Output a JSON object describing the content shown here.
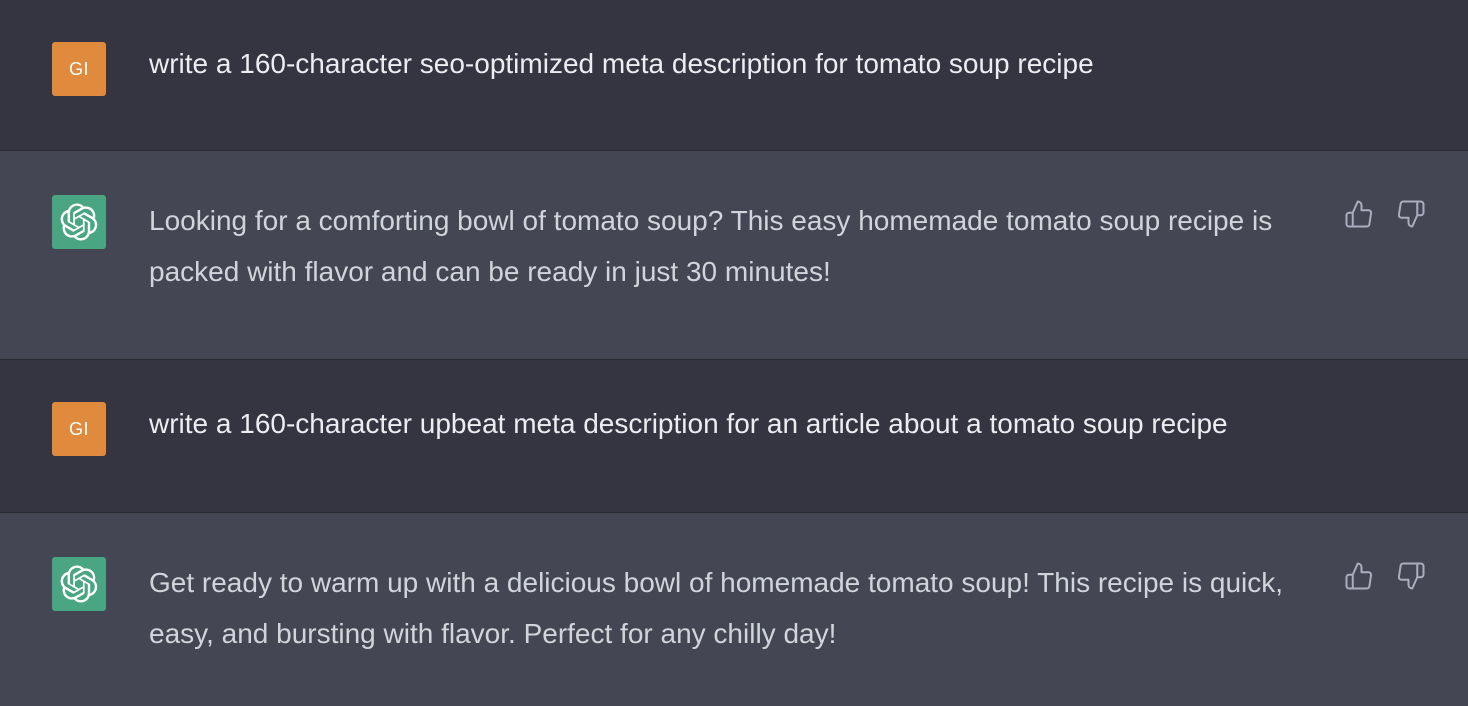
{
  "conversation": [
    {
      "role": "user",
      "avatar_initials": "GI",
      "avatar_color": "#df8a3d",
      "text": "write a 160-character seo-optimized meta description for tomato soup recipe"
    },
    {
      "role": "assistant",
      "avatar_icon": "openai-logo-icon",
      "avatar_color": "#4aa582",
      "text": "Looking for a comforting bowl of tomato soup? This easy homemade tomato soup recipe is packed with flavor and can be ready in just 30 minutes!",
      "feedback_icons": [
        "thumbs-up-icon",
        "thumbs-down-icon"
      ]
    },
    {
      "role": "user",
      "avatar_initials": "GI",
      "avatar_color": "#df8a3d",
      "text": "write a 160-character upbeat meta description for an article about a tomato soup recipe"
    },
    {
      "role": "assistant",
      "avatar_icon": "openai-logo-icon",
      "avatar_color": "#4aa582",
      "text": "Get ready to warm up with a delicious bowl of homemade tomato soup! This recipe is quick, easy, and bursting with flavor. Perfect for any chilly day!",
      "feedback_icons": [
        "thumbs-up-icon",
        "thumbs-down-icon"
      ]
    }
  ],
  "colors": {
    "user_row_bg": "#343541",
    "assistant_row_bg": "#444654",
    "text": "#ececf1",
    "icon": "#acacbe"
  }
}
